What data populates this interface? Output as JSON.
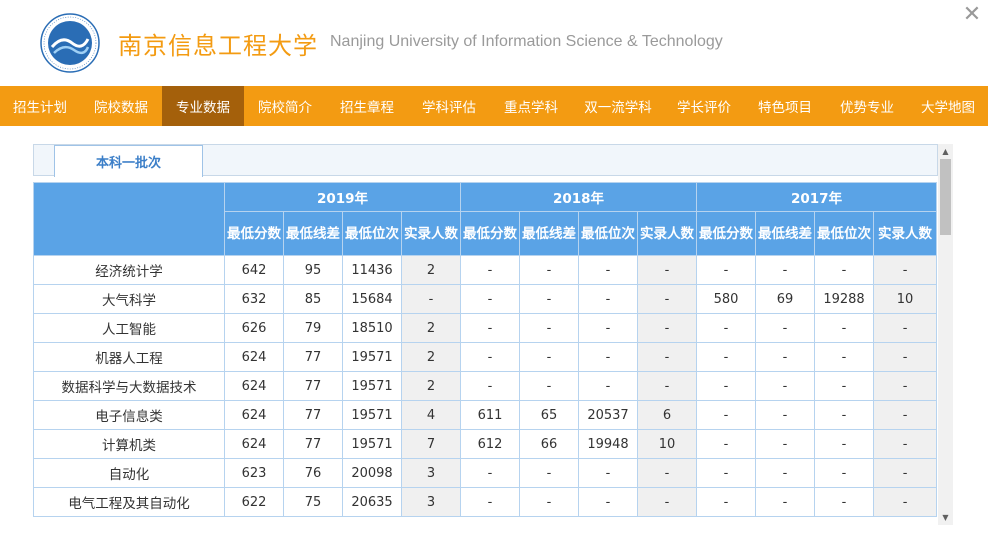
{
  "header": {
    "title_cn": "南京信息工程大学",
    "title_en": "Nanjing University of Information Science & Technology",
    "close_glyph": "✕"
  },
  "nav": {
    "items": [
      {
        "label": "招生计划",
        "active": false
      },
      {
        "label": "院校数据",
        "active": false
      },
      {
        "label": "专业数据",
        "active": true
      },
      {
        "label": "院校简介",
        "active": false
      },
      {
        "label": "招生章程",
        "active": false
      },
      {
        "label": "学科评估",
        "active": false
      },
      {
        "label": "重点学科",
        "active": false
      },
      {
        "label": "双一流学科",
        "active": false
      },
      {
        "label": "学长评价",
        "active": false
      },
      {
        "label": "特色项目",
        "active": false
      },
      {
        "label": "优势专业",
        "active": false
      },
      {
        "label": "大学地图",
        "active": false
      }
    ]
  },
  "tab": {
    "label": "本科一批次"
  },
  "table": {
    "years": [
      "2019年",
      "2018年",
      "2017年"
    ],
    "subheaders": [
      "最低分数",
      "最低线差",
      "最低位次",
      "实录人数"
    ],
    "rows": [
      {
        "name": "经济统计学",
        "values": [
          "642",
          "95",
          "11436",
          "2",
          "-",
          "-",
          "-",
          "-",
          "-",
          "-",
          "-",
          "-"
        ]
      },
      {
        "name": "大气科学",
        "values": [
          "632",
          "85",
          "15684",
          "-",
          "-",
          "-",
          "-",
          "-",
          "580",
          "69",
          "19288",
          "10"
        ]
      },
      {
        "name": "人工智能",
        "values": [
          "626",
          "79",
          "18510",
          "2",
          "-",
          "-",
          "-",
          "-",
          "-",
          "-",
          "-",
          "-"
        ]
      },
      {
        "name": "机器人工程",
        "values": [
          "624",
          "77",
          "19571",
          "2",
          "-",
          "-",
          "-",
          "-",
          "-",
          "-",
          "-",
          "-"
        ]
      },
      {
        "name": "数据科学与大数据技术",
        "values": [
          "624",
          "77",
          "19571",
          "2",
          "-",
          "-",
          "-",
          "-",
          "-",
          "-",
          "-",
          "-"
        ]
      },
      {
        "name": "电子信息类",
        "values": [
          "624",
          "77",
          "19571",
          "4",
          "611",
          "65",
          "20537",
          "6",
          "-",
          "-",
          "-",
          "-"
        ]
      },
      {
        "name": "计算机类",
        "values": [
          "624",
          "77",
          "19571",
          "7",
          "612",
          "66",
          "19948",
          "10",
          "-",
          "-",
          "-",
          "-"
        ]
      },
      {
        "name": "自动化",
        "values": [
          "623",
          "76",
          "20098",
          "3",
          "-",
          "-",
          "-",
          "-",
          "-",
          "-",
          "-",
          "-"
        ]
      },
      {
        "name": "电气工程及其自动化",
        "values": [
          "622",
          "75",
          "20635",
          "3",
          "-",
          "-",
          "-",
          "-",
          "-",
          "-",
          "-",
          "-"
        ]
      }
    ]
  },
  "colors": {
    "accent": "#f39b12",
    "nav_active": "#a4600b",
    "table_header": "#5aa3e6",
    "shade": "#f0f0f0"
  }
}
